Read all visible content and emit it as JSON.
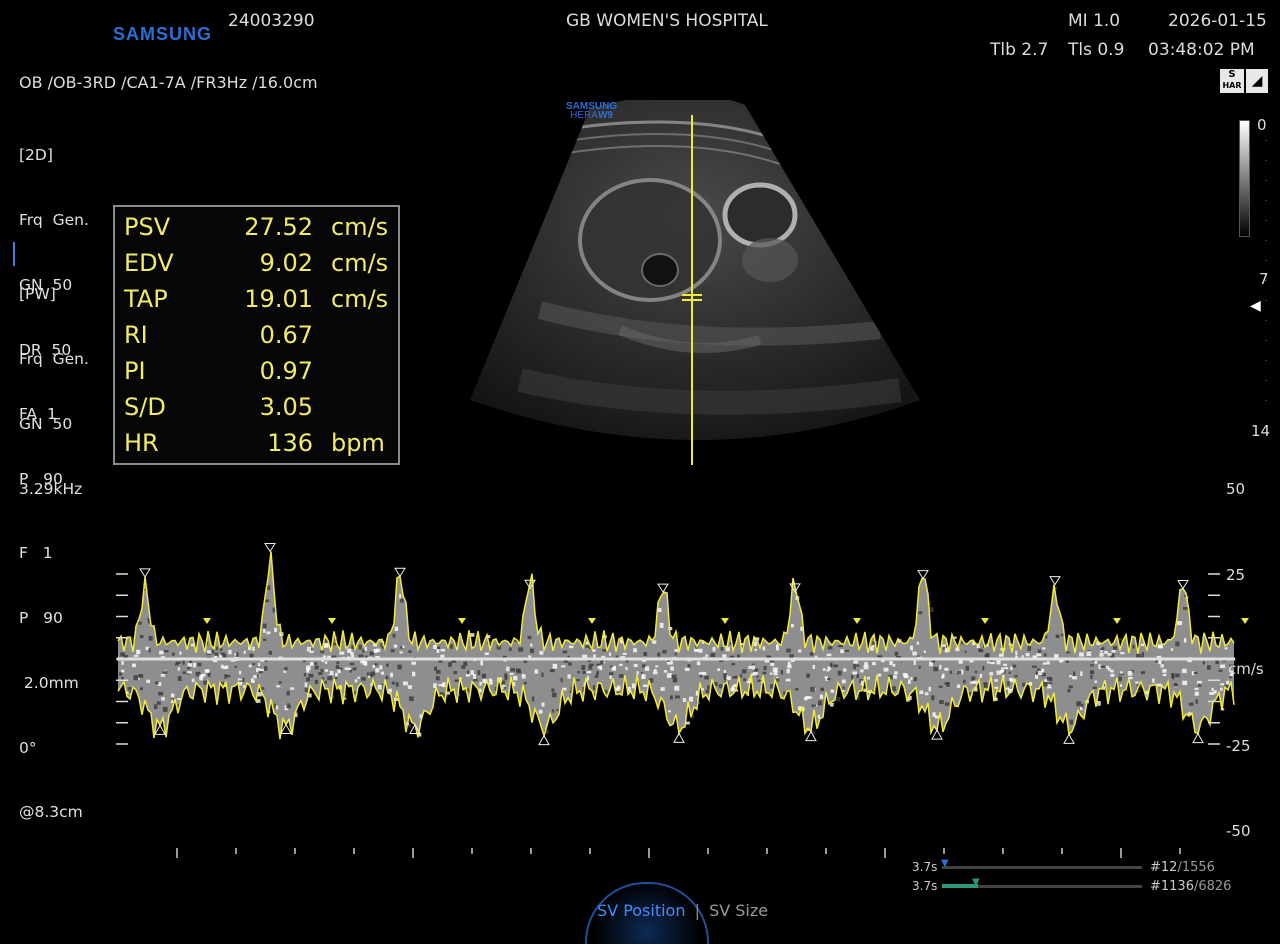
{
  "header": {
    "brand": "SAMSUNG",
    "patient_id": "24003290",
    "hospital": "GB WOMEN'S HOSPITAL",
    "mi": "MI  1.0",
    "date": "2026-01-15",
    "tib": "Tlb 2.7",
    "tis": "Tls 0.9",
    "time": "03:48:02 PM",
    "exam_line": "OB /OB-3RD /CA1-7A /FR3Hz /16.0cm",
    "har_badge_top": "S",
    "har_badge_bottom": "HAR"
  },
  "logo": {
    "line1": "SAMSUNG",
    "line2": "HERA",
    "line3": "W9"
  },
  "params_2d": {
    "title": "[2D]",
    "rows": [
      "Frq  Gen.",
      "GN  50",
      "DR  50",
      "FA  1",
      "P   90"
    ]
  },
  "params_pw": {
    "title": "[PW]",
    "rows": [
      "Frq  Gen.",
      "GN  50",
      "3.29kHz",
      "F   1",
      "P   90",
      " 2.0mm",
      "0°",
      "@8.3cm"
    ]
  },
  "measurements": [
    {
      "label": "PSV",
      "value": "27.52",
      "unit": "cm/s"
    },
    {
      "label": "EDV",
      "value": "9.02",
      "unit": "cm/s"
    },
    {
      "label": "TAP",
      "value": "19.01",
      "unit": "cm/s"
    },
    {
      "label": "RI",
      "value": "0.67",
      "unit": ""
    },
    {
      "label": "PI",
      "value": "0.97",
      "unit": ""
    },
    {
      "label": "S/D",
      "value": "3.05",
      "unit": ""
    },
    {
      "label": "HR",
      "value": "136",
      "unit": "bpm"
    }
  ],
  "depth_scale": {
    "top": "0",
    "mid": "7",
    "bottom": "14"
  },
  "velocity_scale": {
    "labels": [
      "50",
      "25",
      "cm/s",
      "-25",
      "-50"
    ],
    "max": 50,
    "min": -50
  },
  "cine": {
    "row1_time": "3.7s",
    "row1_frame": "#12",
    "row1_total": "/1556",
    "row2_time": "3.7s",
    "row2_frame": "#1136",
    "row2_total": "/6826"
  },
  "controls": {
    "active": "SV Position",
    "separator": "|",
    "inactive": "SV Size"
  },
  "colors": {
    "trace": "#f2ea3a",
    "brand": "#2b6fd6",
    "scale": "#dcdcdc"
  }
}
